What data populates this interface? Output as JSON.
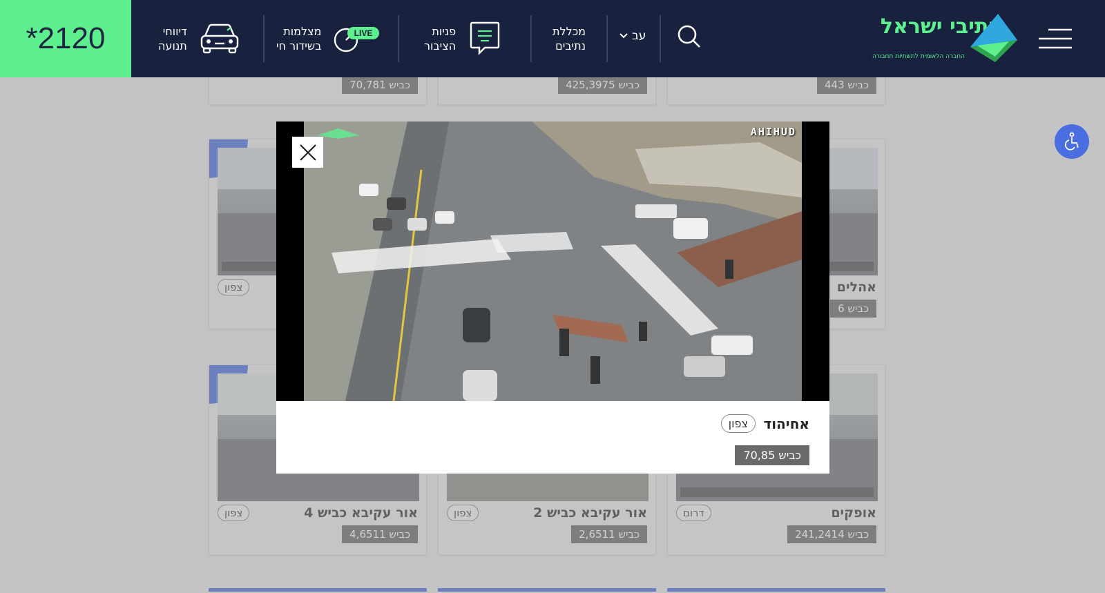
{
  "header": {
    "hotline": "*2120",
    "traffic_reports": [
      "דיווחי",
      "תנועה"
    ],
    "live_cameras": [
      "מצלמות",
      "בשידור חי"
    ],
    "live_badge": "LIVE",
    "public_inquiries": [
      "פניות",
      "הציבור"
    ],
    "netivim_college": [
      "מכללת",
      "נתיבים"
    ],
    "language": "עב",
    "logo_text": "נתיבי ישראל",
    "logo_subtitle": "החברה הלאומית לתשתיות תחבורה"
  },
  "top_row_roads": [
    "כביש 443",
    "כביש 425,3975",
    "כביש 70,781"
  ],
  "cards": [
    {
      "name": "אהלים",
      "road": "כביש 6",
      "direction": ""
    },
    {
      "name": "",
      "road": "",
      "direction": "צפון"
    },
    {
      "name": "אופקים",
      "road": "כביש 241,2414",
      "direction": "דרום"
    },
    {
      "name": "אור עקיבא כביש 2",
      "road": "כביש 2,6511",
      "direction": "צפון"
    },
    {
      "name": "אור עקיבא כביש 4",
      "road": "כביש 4,6511",
      "direction": "צפון"
    }
  ],
  "modal": {
    "camera_overlay_label": "AHIHUD",
    "title": "אחיהוד",
    "direction": "צפון",
    "road": "כביש 70,85"
  },
  "colors": {
    "header_bg": "#18223f",
    "hotline_bg": "#5ef08e",
    "accent_blue": "#4a6ee0",
    "road_badge_bg": "#6a6a6a"
  }
}
